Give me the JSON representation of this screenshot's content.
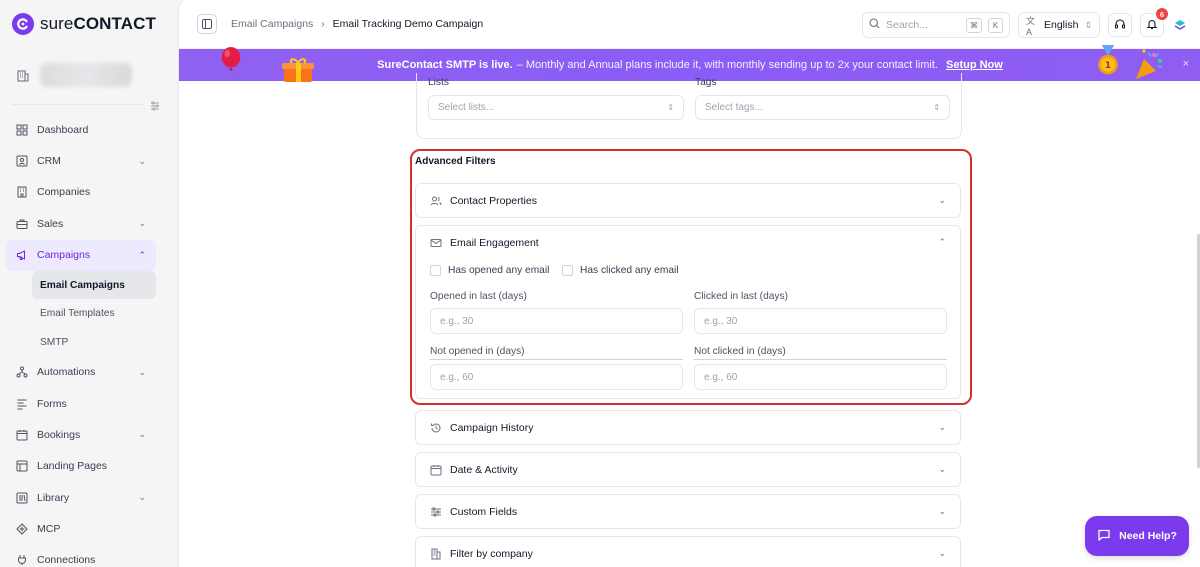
{
  "brand": {
    "name_light": "sure",
    "name_bold": "CONTACT",
    "accent": "#7c3aed"
  },
  "sidebar": {
    "items": [
      {
        "label": "Dashboard",
        "icon": "dashboard-icon",
        "expandable": false
      },
      {
        "label": "CRM",
        "icon": "contact-card-icon",
        "expandable": true
      },
      {
        "label": "Companies",
        "icon": "building-icon",
        "expandable": false
      },
      {
        "label": "Sales",
        "icon": "briefcase-icon",
        "expandable": true
      },
      {
        "label": "Campaigns",
        "icon": "megaphone-icon",
        "expandable": true,
        "active": true
      },
      {
        "label": "Automations",
        "icon": "workflow-icon",
        "expandable": true
      },
      {
        "label": "Forms",
        "icon": "forms-icon",
        "expandable": false
      },
      {
        "label": "Bookings",
        "icon": "calendar-icon",
        "expandable": true
      },
      {
        "label": "Landing Pages",
        "icon": "layout-icon",
        "expandable": false
      },
      {
        "label": "Library",
        "icon": "library-icon",
        "expandable": true
      },
      {
        "label": "MCP",
        "icon": "mcp-icon",
        "expandable": false
      },
      {
        "label": "Connections",
        "icon": "plug-icon",
        "expandable": false
      }
    ],
    "campaign_sub": [
      "Email Campaigns",
      "Email Templates",
      "SMTP"
    ]
  },
  "topbar": {
    "breadcrumb_parent": "Email Campaigns",
    "breadcrumb_current": "Email Tracking Demo Campaign",
    "search_placeholder": "Search...",
    "kbd_cmd": "⌘",
    "kbd_key": "K",
    "language": "English",
    "notifications": "6"
  },
  "banner": {
    "bold": "SureContact SMTP is live.",
    "message": "– Monthly and Annual plans include it, with monthly sending up to 2x your contact limit.",
    "link": "Setup Now"
  },
  "filters": {
    "lists_label": "Lists",
    "lists_placeholder": "Select lists...",
    "tags_label": "Tags",
    "tags_placeholder": "Select tags...",
    "advanced_title": "Advanced Filters",
    "contact_properties": "Contact Properties",
    "email_engagement": "Email Engagement",
    "has_opened": "Has opened any email",
    "has_clicked": "Has clicked any email",
    "opened_last_label": "Opened in last (days)",
    "opened_last_placeholder": "e.g., 30",
    "clicked_last_label": "Clicked in last (days)",
    "clicked_last_placeholder": "e.g., 30",
    "not_opened_label": "Not opened in (days)",
    "not_opened_placeholder": "e.g., 60",
    "not_clicked_label": "Not clicked in (days)",
    "not_clicked_placeholder": "e.g., 60",
    "campaign_history": "Campaign History",
    "date_activity": "Date & Activity",
    "custom_fields": "Custom Fields",
    "filter_company": "Filter by company"
  },
  "help_button": "Need Help?"
}
